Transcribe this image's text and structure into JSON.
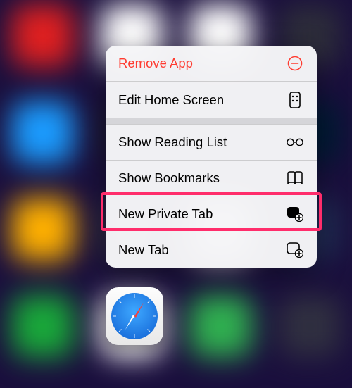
{
  "menu": {
    "remove_app": "Remove App",
    "edit_home_screen": "Edit Home Screen",
    "show_reading_list": "Show Reading List",
    "show_bookmarks": "Show Bookmarks",
    "new_private_tab": "New Private Tab",
    "new_tab": "New Tab"
  },
  "highlighted_item": "new_private_tab",
  "app": {
    "name": "Safari"
  },
  "colors": {
    "destructive": "#ff3b30",
    "highlight_border": "#ff2d6b",
    "menu_bg": "#f5f5f7"
  }
}
